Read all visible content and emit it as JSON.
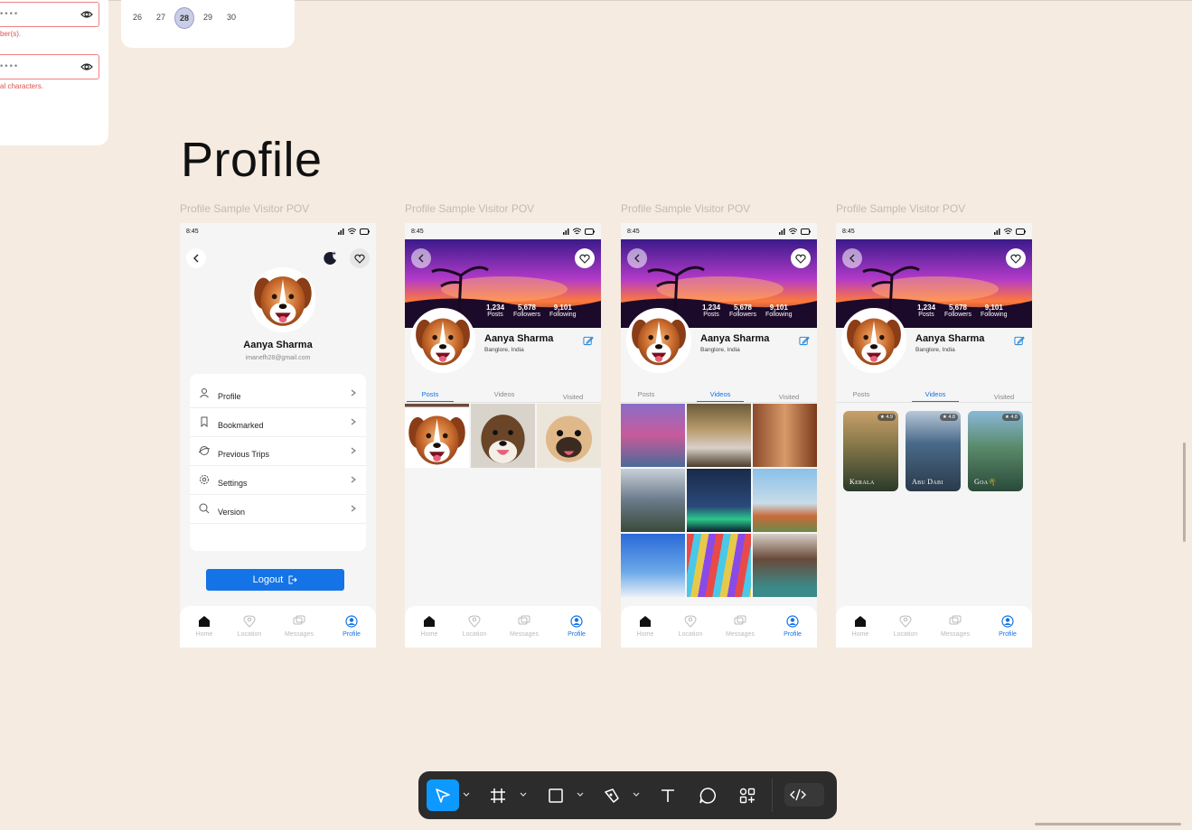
{
  "top_left": {
    "field1_dots": "••••",
    "field1_error": "ber(s).",
    "field2_dots": "••••",
    "field2_error": "al characters."
  },
  "calendar": {
    "days": [
      "26",
      "27",
      "28",
      "29",
      "30"
    ],
    "selected": "28"
  },
  "section_title": "Profile",
  "frames": [
    {
      "label": "Profile Sample Visitor POV",
      "time": "8:45",
      "name": "Aanya Sharma",
      "email": "imanefh28@gmail.com",
      "menu": [
        "Profile",
        "Bookmarked",
        "Previous Trips",
        "Settings",
        "Version"
      ],
      "logout": "Logout"
    },
    {
      "label": "Profile Sample Visitor POV",
      "time": "8:45",
      "stats": [
        {
          "value": "1,234",
          "label": "Posts"
        },
        {
          "value": "5,678",
          "label": "Followers"
        },
        {
          "value": "9,101",
          "label": "Following"
        }
      ],
      "name": "Aanya Sharma",
      "location": "Banglore, India",
      "tabs": [
        "Posts",
        "Videos",
        "Visited"
      ],
      "active_tab": "Posts"
    },
    {
      "label": "Profile Sample Visitor POV",
      "time": "8:45",
      "stats": [
        {
          "value": "1,234",
          "label": "Posts"
        },
        {
          "value": "5,678",
          "label": "Followers"
        },
        {
          "value": "9,101",
          "label": "Following"
        }
      ],
      "name": "Aanya Sharma",
      "location": "Banglore, India",
      "tabs": [
        "Posts",
        "Videos",
        "Visited"
      ],
      "active_tab": "Videos"
    },
    {
      "label": "Profile Sample Visitor POV",
      "time": "8:45",
      "stats": [
        {
          "value": "1,234",
          "label": "Posts"
        },
        {
          "value": "5,678",
          "label": "Followers"
        },
        {
          "value": "9,101",
          "label": "Following"
        }
      ],
      "name": "Aanya Sharma",
      "location": "Banglore, India",
      "tabs": [
        "Posts",
        "Videos",
        "Visited"
      ],
      "active_tab": "Videos",
      "destinations": [
        {
          "name": "Kerala",
          "rating": "4.9"
        },
        {
          "name": "Abu Dabi",
          "rating": "4.8"
        },
        {
          "name": "Goa🌴",
          "rating": "4.8"
        }
      ]
    }
  ],
  "bottom_nav": [
    "Home",
    "Location",
    "Messages",
    "Profile"
  ],
  "toolbar": {
    "tools": [
      "move-tool",
      "frame-tool",
      "shape-tool",
      "pen-tool",
      "text-tool",
      "comment-tool",
      "actions-tool"
    ],
    "active": "move-tool"
  },
  "colors": {
    "canvas": "#f5ebe0",
    "accent": "#1473e6",
    "toolbar": "#2c2c2c",
    "tool_active": "#0d99ff"
  }
}
